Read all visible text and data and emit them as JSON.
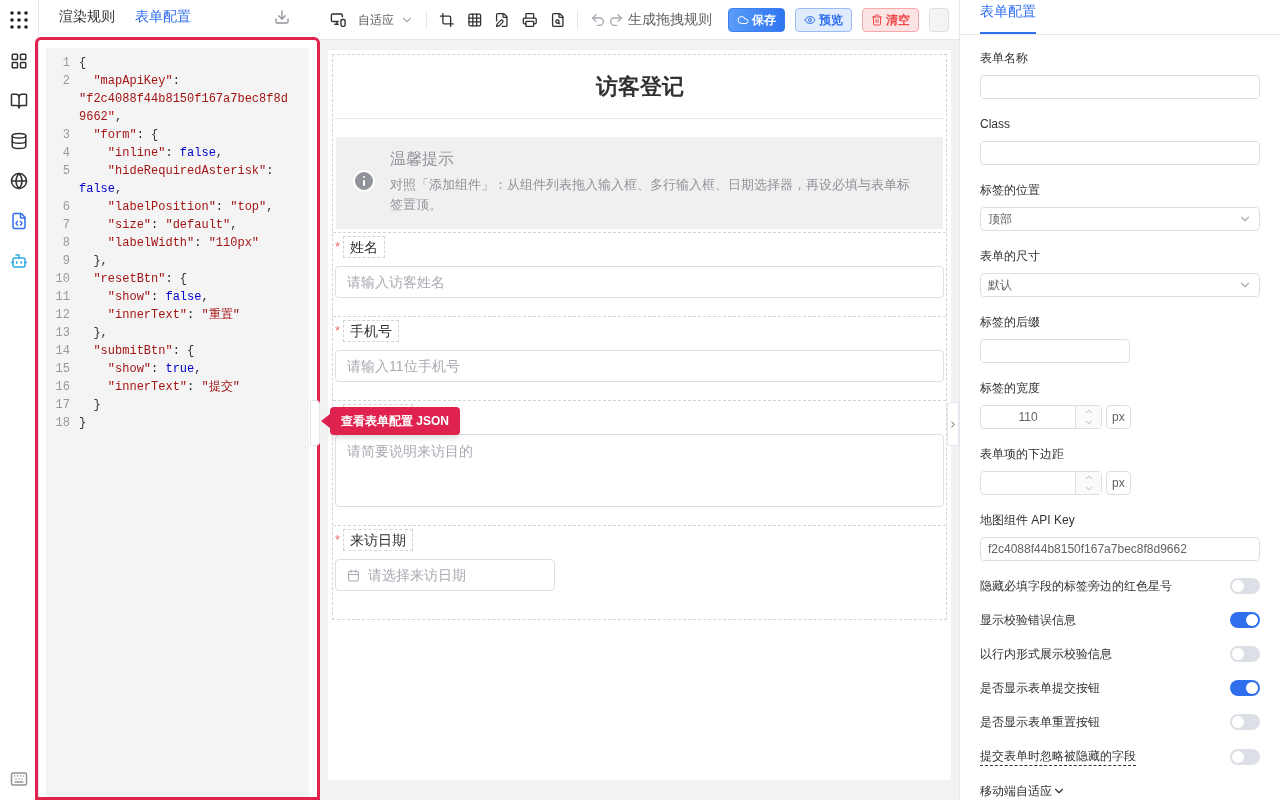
{
  "left_panel": {
    "tabs": [
      {
        "label": "渲染规则",
        "selected": false
      },
      {
        "label": "表单配置",
        "selected": true
      }
    ],
    "code_lines": [
      {
        "num": "1",
        "text": "{"
      },
      {
        "num": "2",
        "text": "  \"mapApiKey\": \"f2c4088f44b8150f167a7bec8f8d9662\","
      },
      {
        "num": "3",
        "text": "  \"form\": {"
      },
      {
        "num": "4",
        "text": "    \"inline\": false,"
      },
      {
        "num": "5",
        "text": "    \"hideRequiredAsterisk\": false,"
      },
      {
        "num": "6",
        "text": "    \"labelPosition\": \"top\","
      },
      {
        "num": "7",
        "text": "    \"size\": \"default\","
      },
      {
        "num": "8",
        "text": "    \"labelWidth\": \"110px\""
      },
      {
        "num": "9",
        "text": "  },"
      },
      {
        "num": "10",
        "text": "  \"resetBtn\": {"
      },
      {
        "num": "11",
        "text": "    \"show\": false,"
      },
      {
        "num": "12",
        "text": "    \"innerText\": \"重置\""
      },
      {
        "num": "13",
        "text": "  },"
      },
      {
        "num": "14",
        "text": "  \"submitBtn\": {"
      },
      {
        "num": "15",
        "text": "    \"show\": true,"
      },
      {
        "num": "16",
        "text": "    \"innerText\": \"提交\""
      },
      {
        "num": "17",
        "text": "  }"
      },
      {
        "num": "18",
        "text": "}"
      }
    ],
    "tooltip": "查看表单配置 JSON"
  },
  "toolbar": {
    "device_select": "自适应",
    "generate_rule": "生成拖拽规则",
    "buttons": [
      {
        "kind": "save",
        "label": "保存"
      },
      {
        "kind": "preview",
        "label": "预览"
      },
      {
        "kind": "clear",
        "label": "清空"
      }
    ]
  },
  "form": {
    "title": "访客登记",
    "alert": {
      "title": "温馨提示",
      "text": "对照「添加组件」：从组件列表拖入输入框、多行输入框、日期选择器，再设必填与表单标签置顶。"
    },
    "fields": [
      {
        "kind": "input",
        "label": "姓名",
        "asterisk": "*",
        "placeholder": "请输入访客姓名"
      },
      {
        "kind": "input",
        "label": "手机号",
        "asterisk": "*",
        "placeholder": "请输入11位手机号"
      },
      {
        "kind": "textarea",
        "placeholder": "请简要说明来访目的"
      },
      {
        "kind": "date",
        "label": "来访日期",
        "asterisk": "*",
        "placeholder": "请选择来访日期"
      }
    ]
  },
  "right_panel": {
    "tab": "表单配置",
    "settings": [
      {
        "kind": "text",
        "label": "表单名称"
      },
      {
        "kind": "text",
        "label": "Class"
      },
      {
        "kind": "select",
        "label": "标签的位置",
        "value": "顶部"
      },
      {
        "kind": "select",
        "label": "表单的尺寸",
        "value": "默认"
      },
      {
        "kind": "short",
        "label": "标签的后缀"
      },
      {
        "kind": "number",
        "label": "标签的宽度",
        "value": "110",
        "unit": "px"
      },
      {
        "kind": "number",
        "label": "表单项的下边距",
        "unit": "px"
      },
      {
        "kind": "text",
        "label": "地图组件 API Key",
        "value": "f2c4088f44b8150f167a7bec8f8d9662"
      },
      {
        "kind": "switch",
        "label": "隐藏必填字段的标签旁边的红色星号",
        "on": false
      },
      {
        "kind": "switch",
        "label": "显示校验错误信息",
        "on": true
      },
      {
        "kind": "switch",
        "label": "以行内形式展示校验信息",
        "on": false
      },
      {
        "kind": "switch",
        "label": "是否显示表单提交按钮",
        "on": true
      },
      {
        "kind": "switch",
        "label": "是否显示表单重置按钮",
        "on": false
      },
      {
        "kind": "switch",
        "label": "提交表单时忽略被隐藏的字段",
        "on": false,
        "dotted": true
      },
      {
        "kind": "collapse",
        "label": "移动端自适应"
      }
    ]
  }
}
